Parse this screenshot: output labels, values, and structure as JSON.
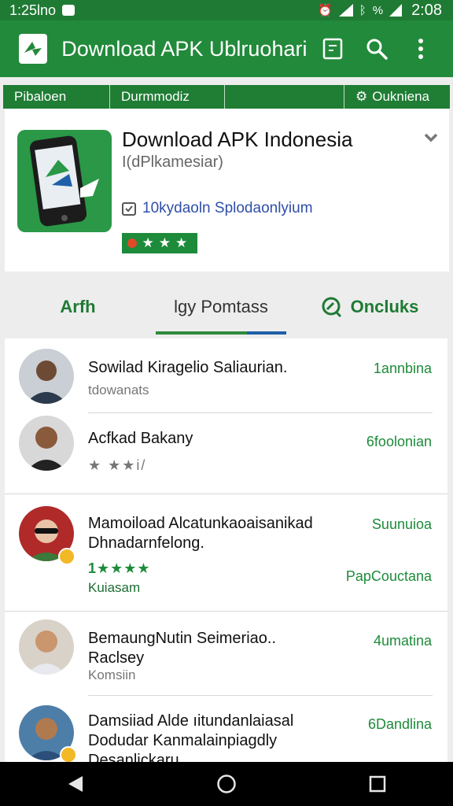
{
  "status_bar": {
    "left_text": "1:25lno",
    "right_percent": "%",
    "time": "2:08"
  },
  "app_bar": {
    "title": "Download APK Ublruohari",
    "icons": [
      "app-logo-icon",
      "bookmark-icon",
      "search-icon",
      "more-vert-icon"
    ]
  },
  "sub_tabs": [
    "Pibaloen",
    "Durmmodiz",
    "Oukniena"
  ],
  "app_card": {
    "name": "Download APK Indonesia",
    "developer": "I(dPlkamesiar)",
    "meta": "10kydaoln Splodaonlyium",
    "rating_stars": "★★★",
    "colors": {
      "brand": "#228a3b",
      "badge": "#1d8b3a",
      "meta_text": "#2f4fa8"
    }
  },
  "main_tabs": [
    {
      "label": "Arfh"
    },
    {
      "label": "lgy Pomtass"
    },
    {
      "label": "Oncluks"
    }
  ],
  "reviews": [
    {
      "title": "Sowilad Kiragelio Saliaurian.",
      "sub": "tdowanats",
      "right": "1annbina"
    },
    {
      "title": "Acfkad Bakany",
      "stars": "★ ★★i/",
      "right": "6foolonian"
    },
    {
      "title": "Mamoiload Alcatunkaoaisanikad Dhnadarnfelong.",
      "stars": "1★★★★",
      "label": "Kuiasam",
      "right": "Suunuioa",
      "right2": "PapCouctana"
    },
    {
      "title": "BemaungNutin Seimeriao.. Raclsey",
      "sub": "Komsiin",
      "right": "4umatina"
    },
    {
      "title": "Damsiiad Alde ıitundanlaiasal Dodudar Kanmalainpiagdly Desanlickaru",
      "right": "6Dandlina"
    }
  ]
}
